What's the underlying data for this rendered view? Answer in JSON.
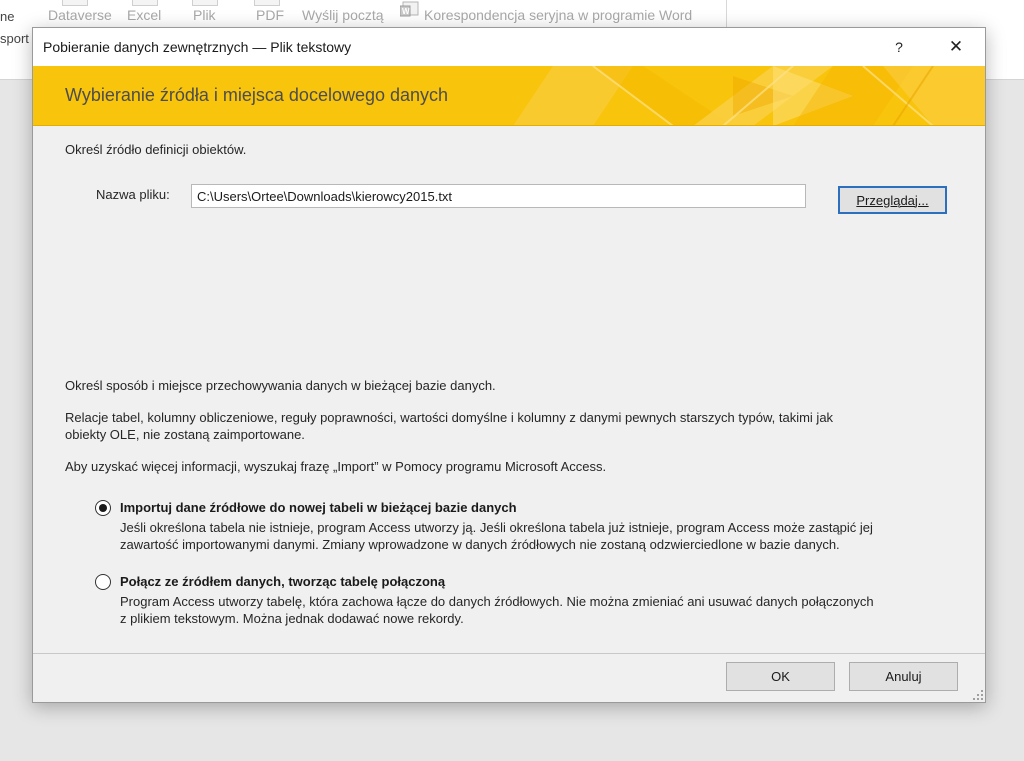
{
  "ribbon": {
    "left_line1": "ne",
    "left_line2": "sport",
    "items": [
      "Dataverse",
      "Excel",
      "Plik",
      "PDF",
      "Wyślij pocztą"
    ],
    "mail_merge": "Korespondencja seryjna w programie Word"
  },
  "dialog": {
    "title": "Pobieranie danych zewnętrznych — Plik tekstowy",
    "help_glyph": "?",
    "close_glyph": "✕",
    "banner_title": "Wybieranie źródła i miejsca docelowego danych",
    "source_instruction": "Określ źródło definicji obiektów.",
    "file_label": "Nazwa pliku:",
    "file_value": "C:\\Users\\Ortee\\Downloads\\kierowcy2015.txt",
    "browse_label": "Przeglądaj...",
    "storage_instruction": "Określ sposób i miejsce przechowywania danych w bieżącej bazie danych.",
    "warning_line1": "Relacje tabel, kolumny obliczeniowe, reguły poprawności, wartości domyślne i kolumny z danymi pewnych starszych typów, takimi jak",
    "warning_line2": "obiekty OLE, nie zostaną zaimportowane.",
    "help_info": "Aby uzyskać więcej informacji, wyszukaj frazę „Import” w Pomocy programu Microsoft Access.",
    "options": [
      {
        "label": "Importuj dane źródłowe do nowej tabeli w bieżącej bazie danych",
        "selected": true,
        "desc_line1": "Jeśli określona tabela nie istnieje, program Access utworzy ją. Jeśli określona tabela już istnieje, program Access może zastąpić jej",
        "desc_line2": "zawartość importowanymi danymi. Zmiany wprowadzone w danych źródłowych nie zostaną odzwierciedlone w bazie danych."
      },
      {
        "label": "Połącz ze źródłem danych, tworząc tabelę połączoną",
        "selected": false,
        "desc_line1": "Program Access utworzy tabelę, która zachowa łącze do danych źródłowych. Nie można zmieniać ani usuwać danych połączonych",
        "desc_line2": "z plikiem tekstowym. Można jednak dodawać nowe rekordy."
      }
    ],
    "ok_label": "OK",
    "cancel_label": "Anuluj"
  },
  "colors": {
    "banner_yellow": "#f8c40c",
    "banner_text": "#4d4d4d",
    "focus_blue": "#2d6fbf",
    "dialog_bg": "#f0f0f0"
  },
  "icons": [
    "word-mail-merge-icon",
    "help-icon",
    "close-icon",
    "resize-grip-icon"
  ]
}
